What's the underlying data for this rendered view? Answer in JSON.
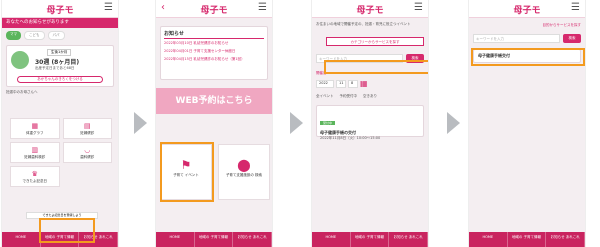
{
  "app": {
    "title": "母子モ",
    "menu_icon": "hamburger-icon",
    "back_icon": "chevron-left-icon"
  },
  "screen1": {
    "pinkbar_text": "あなたへのお知らせがあります",
    "tabs": [
      "ママ",
      "こども",
      "パパ"
    ],
    "child_age_label": "生後1か月",
    "weeks_label": "30週 (8ヶ月目)",
    "due_text": "出産予定日まであと68日",
    "link_text": "あかちゃんのきろくをつける",
    "info_title": "妊娠中のお母さんへ",
    "tiles": [
      "体重グラフ",
      "妊婦健診",
      "妊婦歯科検診",
      "歯科健診",
      "できたよ記念日"
    ],
    "bottom_banner": "できたよ記念日を登録しよう",
    "nav": [
      "HOME",
      "地域の\n子育て情報",
      "お知らせ\nあれこれ"
    ]
  },
  "screen2": {
    "news_title": "お知らせ",
    "news": [
      "2022年03月10日 乳幼児健診のお知らせ",
      "2022年04月01日 子育て支援センター休館日",
      "2022年04月15日 乳幼児健診のお知らせ（第1回）"
    ],
    "web_banner": "WEB予約はこちら",
    "tiles": [
      "子育て\nイベント",
      "子育て支援施設の\n検索"
    ],
    "nav": [
      "HOME",
      "地域の\n子育て情報",
      "お知らせ\nあれこれ"
    ]
  },
  "screen3": {
    "intro": "お住まいの地域で開催予定の、妊娠・育児に役立つイベント",
    "category_button": "カテゴリーからサービスを探す",
    "search_placeholder": "キーワードを入力",
    "search_button": "検索",
    "date_label": "開催日",
    "date_year": "2022",
    "date_month": "11",
    "date_day": "8",
    "checks": [
      "全イベント",
      "予約受付中",
      "空きあり"
    ],
    "event_badge": "受付中",
    "event_title": "母子健康手帳の交付",
    "event_date": "2022年11月8日（火）10:00〜15:00",
    "nav": [
      "HOME",
      "地域の\n子育て情報",
      "お知らせ\nあれこれ"
    ]
  },
  "screen4": {
    "back_link": "目的からサービスを探す",
    "search_placeholder": "キーワードを入力",
    "search_button": "検索",
    "result": "母子健康手帳交付",
    "nav": [
      "HOME",
      "地域の\n子育て情報",
      "お知らせ\nあれこれ"
    ]
  }
}
